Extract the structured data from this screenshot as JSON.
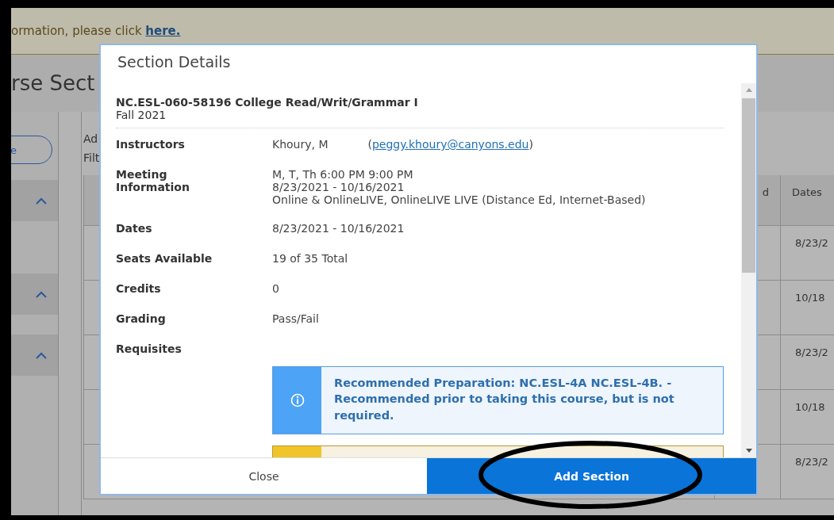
{
  "banner": {
    "text": "ormation, please click ",
    "link": "here."
  },
  "page_title": "rse Sect",
  "sidebar": {
    "button": "e",
    "groups": [
      {
        "expanded": true
      },
      {
        "expanded": true
      },
      {
        "expanded": true
      }
    ]
  },
  "main": {
    "lines": [
      "Ad",
      "Filt"
    ]
  },
  "table": {
    "columns": [
      "d",
      "Dates"
    ],
    "rows": [
      {
        "dates": "8/23/2"
      },
      {
        "dates": "10/18"
      },
      {
        "dates": "8/23/2"
      },
      {
        "dates": "10/18"
      },
      {
        "dates": "8/23/2"
      }
    ]
  },
  "dialog": {
    "title": "Section Details",
    "course": {
      "title": "NC.ESL-060-58196 College Read/Writ/Grammar I",
      "term": "Fall 2021"
    },
    "fields": [
      {
        "kind": "contact",
        "label": "Instructors",
        "name": "Khoury, M",
        "contact": [
          "(",
          "peggy.khoury@canyons.edu",
          ")"
        ]
      },
      {
        "kind": "lines",
        "label": "Meeting Information",
        "lines": [
          "M, T, Th 6:00 PM 9:00 PM",
          "8/23/2021 - 10/16/2021",
          "Online & OnlineLIVE, OnlineLIVE LIVE (Distance Ed, Internet-Based)"
        ]
      },
      {
        "kind": "text",
        "label": "Dates",
        "value": "8/23/2021 - 10/16/2021"
      },
      {
        "kind": "text",
        "label": "Seats Available",
        "value": "19 of 35 Total"
      },
      {
        "kind": "text",
        "label": "Credits",
        "value": "0"
      },
      {
        "kind": "text",
        "label": "Grading",
        "value": "Pass/Fail"
      },
      {
        "kind": "alerts",
        "label": "Requisites",
        "alerts": [
          {
            "kind": "info",
            "text": "Recommended Preparation: NC.ESL-4A NC.ESL-4B. - Recommended prior to taking this course, but is not required."
          },
          {
            "kind": "warning"
          }
        ]
      }
    ],
    "buttons": [
      {
        "kind": "secondary",
        "label": "Close"
      },
      {
        "kind": "primary",
        "label": "Add Section"
      }
    ]
  }
}
